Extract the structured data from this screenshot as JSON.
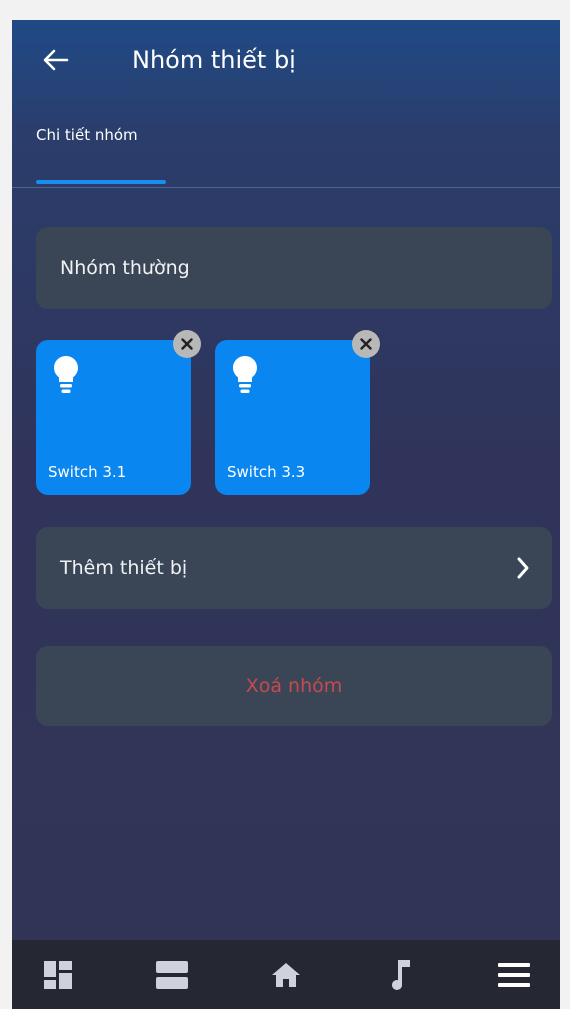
{
  "header": {
    "title": "Nhóm thiết bị"
  },
  "tabs": [
    {
      "label": "Chi tiết nhóm",
      "active": true
    }
  ],
  "group": {
    "type_label": "Nhóm thường"
  },
  "devices": [
    {
      "name": "Switch 3.1",
      "icon": "bulb-icon"
    },
    {
      "name": "Switch 3.3",
      "icon": "bulb-icon"
    }
  ],
  "actions": {
    "add_device_label": "Thêm thiết bị",
    "delete_group_label": "Xoá nhóm"
  },
  "bottom_nav": [
    {
      "icon": "dashboard-icon"
    },
    {
      "icon": "rooms-icon"
    },
    {
      "icon": "home-icon"
    },
    {
      "icon": "music-icon"
    },
    {
      "icon": "menu-icon"
    }
  ],
  "colors": {
    "accent": "#0a86f0",
    "card": "#3a4656",
    "danger": "#c8494f",
    "nav_bg": "#252733"
  }
}
